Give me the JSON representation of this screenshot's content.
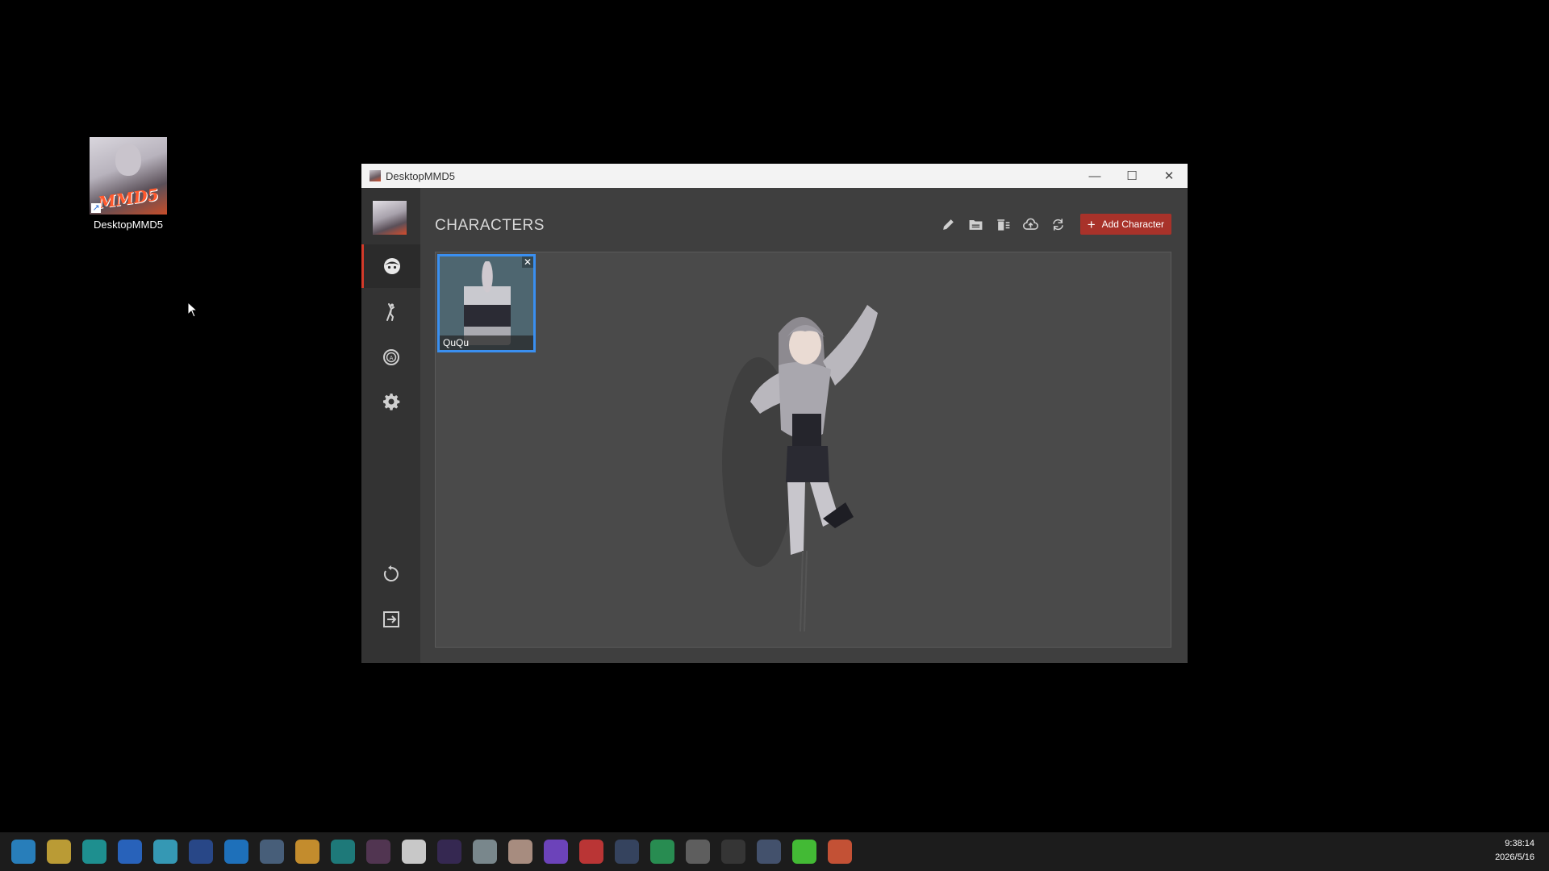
{
  "desktop": {
    "icon_label": "DesktopMMD5",
    "icon_art_text": "MMD5"
  },
  "window": {
    "title": "DesktopMMD5",
    "controls": {
      "minimize": "—",
      "maximize": "☐",
      "close": "✕"
    }
  },
  "sidebar": {
    "items": [
      {
        "name": "characters",
        "icon": "character-face-icon",
        "active": true
      },
      {
        "name": "motions",
        "icon": "dance-figure-icon",
        "active": false
      },
      {
        "name": "auto-actions",
        "icon": "auto-mode-icon",
        "active": false
      },
      {
        "name": "settings",
        "icon": "gear-icon",
        "active": false
      }
    ],
    "bottom_items": [
      {
        "name": "reset",
        "icon": "refresh-circle-icon"
      },
      {
        "name": "exit",
        "icon": "exit-icon"
      }
    ]
  },
  "main": {
    "page_title": "CHARACTERS",
    "toolbar": {
      "edit_icon": "pencil-icon",
      "folder_icon": "folder-icon",
      "delete_icon": "delete-list-icon",
      "upload_icon": "cloud-upload-icon",
      "refresh_icon": "sync-icon",
      "add_label": "Add Character",
      "accent": "#a8322a"
    },
    "characters": [
      {
        "name": "QuQu",
        "selected": true
      }
    ],
    "selection_color": "#3a8ff0"
  },
  "taskbar": {
    "time": "9:38:14",
    "date": "2026/5/16",
    "app_colors": [
      "#2a8fd6",
      "#d6b23a",
      "#1fa3a3",
      "#2a6fd6",
      "#3aaecf",
      "#2a4f9a",
      "#1f7fd6",
      "#4f6a8a",
      "#e0a030",
      "#1f8a8a",
      "#5a3a5a",
      "#e6e6e6",
      "#3a2a5a",
      "#8a9aa0",
      "#c0a090",
      "#7a4ad6",
      "#d63a3a",
      "#3a4a6a",
      "#2aa05a",
      "#6a6a6a",
      "#3a3a3a",
      "#4a5a7a",
      "#4ad63a",
      "#e05a3a"
    ]
  }
}
